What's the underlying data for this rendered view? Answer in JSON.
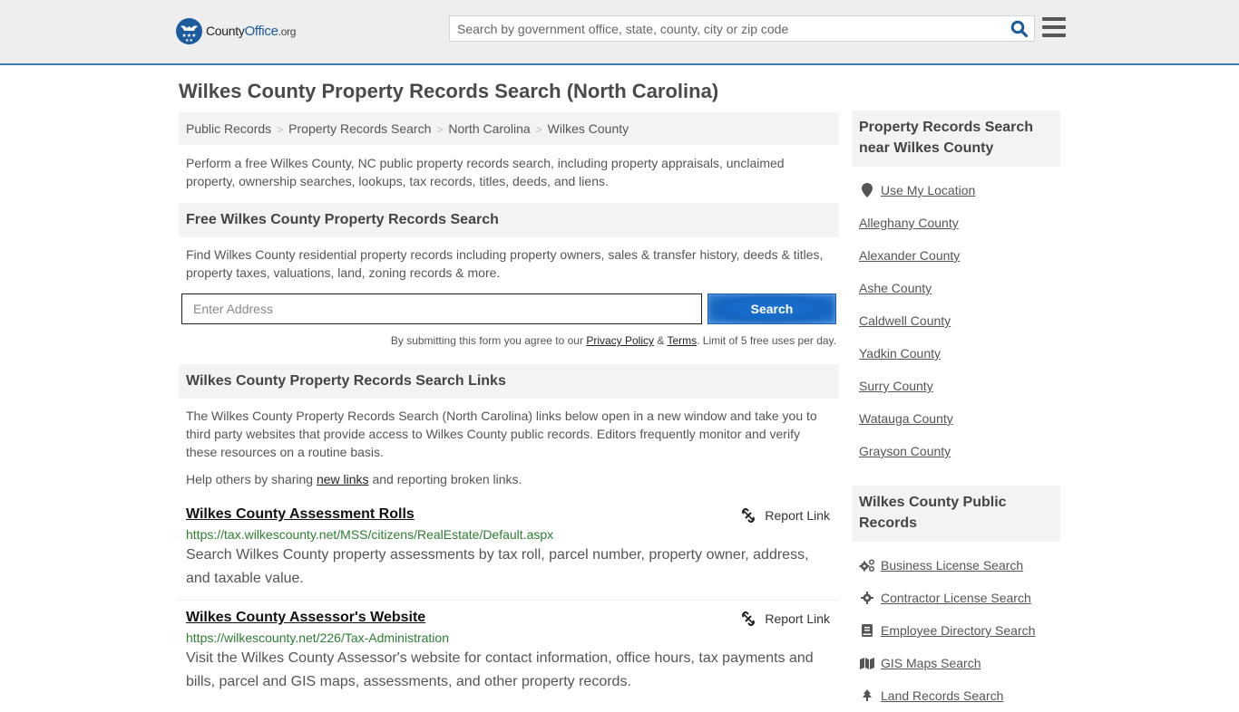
{
  "header": {
    "logo": {
      "name": "County",
      "highlight": "Office",
      "suffix": ".org"
    },
    "search_placeholder": "Search by government office, state, county, city or zip code",
    "colors": {
      "brand": "#1b5b9e",
      "header_border": "#3a7eb1"
    }
  },
  "page": {
    "title": "Wilkes County Property Records Search (North Carolina)",
    "breadcrumb": [
      "Public Records",
      "Property Records Search",
      "North Carolina",
      "Wilkes County"
    ],
    "intro": "Perform a free Wilkes County, NC public property records search, including property appraisals, unclaimed property, ownership searches, lookups, tax records, titles, deeds, and liens."
  },
  "free_search": {
    "heading": "Free Wilkes County Property Records Search",
    "description": "Find Wilkes County residential property records including property owners, sales & transfer history, deeds & titles, property taxes, valuations, land, zoning records & more.",
    "address_placeholder": "Enter Address",
    "button_label": "Search",
    "disclaimer": {
      "prefix": "By submitting this form you agree to our ",
      "privacy": "Privacy Policy",
      "amp": " & ",
      "terms": "Terms",
      "suffix": ". Limit of 5 free uses per day."
    }
  },
  "links_section": {
    "heading": "Wilkes County Property Records Search Links",
    "description": "The Wilkes County Property Records Search (North Carolina) links below open in a new window and take you to third party websites that provide access to Wilkes County public records. Editors frequently monitor and verify these resources on a routine basis.",
    "help": {
      "prefix": "Help others by sharing ",
      "link": "new links",
      "suffix": " and reporting broken links."
    },
    "report_label": "Report Link",
    "records": [
      {
        "title": "Wilkes County Assessment Rolls",
        "url": "https://tax.wilkescounty.net/MSS/citizens/RealEstate/Default.aspx",
        "description": "Search Wilkes County property assessments by tax roll, parcel number, property owner, address, and taxable value."
      },
      {
        "title": "Wilkes County Assessor's Website",
        "url": "https://wilkescounty.net/226/Tax-Administration",
        "description": "Visit the Wilkes County Assessor's website for contact information, office hours, tax payments and bills, parcel and GIS maps, assessments, and other property records."
      }
    ]
  },
  "sidebar": {
    "nearby": {
      "heading": "Property Records Search near Wilkes County",
      "use_location": "Use My Location",
      "counties": [
        "Alleghany County",
        "Alexander County",
        "Ashe County",
        "Caldwell County",
        "Yadkin County",
        "Surry County",
        "Watauga County",
        "Grayson County"
      ]
    },
    "public_records": {
      "heading": "Wilkes County Public Records",
      "items": [
        {
          "label": "Business License Search",
          "icon": "gears-icon"
        },
        {
          "label": "Contractor License Search",
          "icon": "gear-icon"
        },
        {
          "label": "Employee Directory Search",
          "icon": "book-icon"
        },
        {
          "label": "GIS Maps Search",
          "icon": "map-icon"
        },
        {
          "label": "Land Records Search",
          "icon": "tree-icon"
        }
      ]
    }
  }
}
